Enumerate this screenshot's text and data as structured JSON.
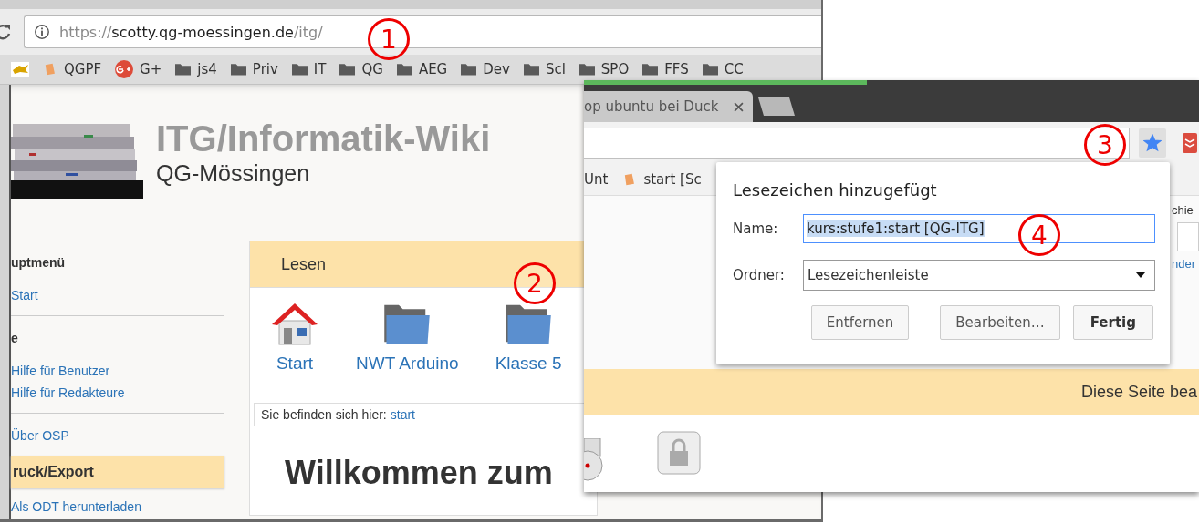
{
  "back_window": {
    "url": {
      "scheme": "https://",
      "host": "scotty.qg-moessingen.de",
      "path": "/itg/"
    },
    "bookmarks": [
      {
        "label": "QGPF",
        "kind": "page"
      },
      {
        "label": "G+",
        "kind": "gplus"
      },
      {
        "label": "js4",
        "kind": "folder"
      },
      {
        "label": "Priv",
        "kind": "folder"
      },
      {
        "label": "IT",
        "kind": "folder"
      },
      {
        "label": "QG",
        "kind": "folder"
      },
      {
        "label": "AEG",
        "kind": "folder"
      },
      {
        "label": "Dev",
        "kind": "folder"
      },
      {
        "label": "Scl",
        "kind": "folder"
      },
      {
        "label": "SPO",
        "kind": "folder"
      },
      {
        "label": "FFS",
        "kind": "folder"
      },
      {
        "label": "CC",
        "kind": "folder"
      }
    ],
    "site": {
      "title": "ITG/Informatik-Wiki",
      "subtitle": "QG-Mössingen"
    },
    "sidebar": [
      {
        "kind": "heading",
        "text": "uptmenü"
      },
      {
        "kind": "link",
        "text": "Start"
      },
      {
        "kind": "divider"
      },
      {
        "kind": "heading",
        "text": "e"
      },
      {
        "kind": "link",
        "text": "Hilfe für Benutzer"
      },
      {
        "kind": "link",
        "text": "Hilfe für Redakteure"
      },
      {
        "kind": "divider"
      },
      {
        "kind": "link",
        "text": "Über OSP"
      },
      {
        "kind": "section",
        "text": "ruck/Export"
      },
      {
        "kind": "link",
        "text": "Als ODT herunterladen"
      }
    ],
    "card": {
      "header": "Lesen",
      "tiles": [
        {
          "label": "Start",
          "kind": "home"
        },
        {
          "label": "NWT Arduino",
          "kind": "folder"
        },
        {
          "label": "Klasse 5",
          "kind": "folder"
        }
      ],
      "breadcrumb": {
        "prefix": "Sie befinden sich hier:",
        "link": "start"
      },
      "heading": "Willkommen zum"
    }
  },
  "front_window": {
    "tab": {
      "title": "op ubuntu bei Duck"
    },
    "bookmark_starred": true,
    "bookmarks": [
      "Unt",
      "start [Sc"
    ],
    "page": {
      "side_label": "chie",
      "side_link": "nder",
      "banner": "Diese Seite bea"
    }
  },
  "bookmark_popup": {
    "title": "Lesezeichen hinzugefügt",
    "name_label": "Name:",
    "name_value": "kurs:stufe1:start [QG-ITG]",
    "folder_label": "Ordner:",
    "folder_value": "Lesezeichenleiste",
    "buttons": [
      {
        "label": "Entfernen",
        "primary": false
      },
      {
        "label": "Bearbeiten…",
        "primary": false
      },
      {
        "label": "Fertig",
        "primary": true
      }
    ]
  },
  "annotations": [
    "1",
    "2",
    "3",
    "4"
  ]
}
